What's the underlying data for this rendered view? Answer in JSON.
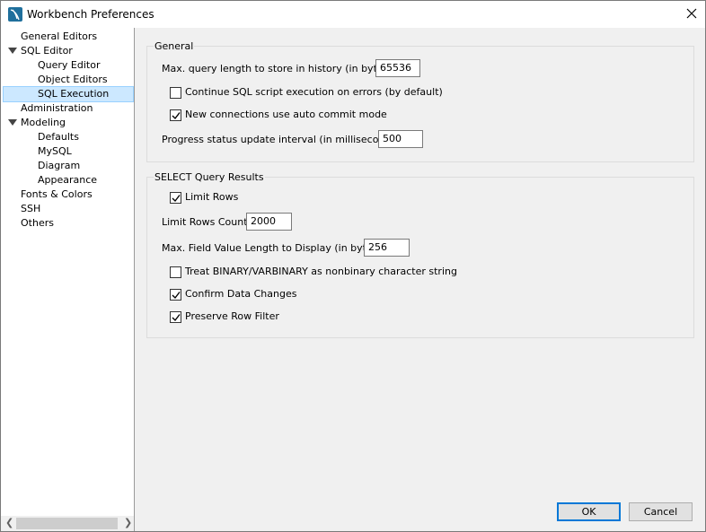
{
  "window": {
    "title": "Workbench Preferences"
  },
  "tree": {
    "items": [
      {
        "label": "General Editors"
      },
      {
        "label": "SQL Editor"
      },
      {
        "label": "Query Editor"
      },
      {
        "label": "Object Editors"
      },
      {
        "label": "SQL Execution",
        "selected": true
      },
      {
        "label": "Administration"
      },
      {
        "label": "Modeling"
      },
      {
        "label": "Defaults"
      },
      {
        "label": "MySQL"
      },
      {
        "label": "Diagram"
      },
      {
        "label": "Appearance"
      },
      {
        "label": "Fonts & Colors"
      },
      {
        "label": "SSH"
      },
      {
        "label": "Others"
      }
    ]
  },
  "general": {
    "title": "General",
    "max_query_label": "Max. query length to store in history (in bytes):",
    "max_query_value": "65536",
    "continue_label": "Continue SQL script execution on errors (by default)",
    "continue_checked": false,
    "autocommit_label": "New connections use auto commit mode",
    "autocommit_checked": true,
    "progress_label": "Progress status update interval (in milliseconds):",
    "progress_value": "500"
  },
  "select_results": {
    "title": "SELECT Query Results",
    "limit_rows_label": "Limit Rows",
    "limit_rows_checked": true,
    "limit_count_label": "Limit Rows Count:",
    "limit_count_value": "2000",
    "max_field_label": "Max. Field Value Length to Display (in bytes):",
    "max_field_value": "256",
    "binary_label": "Treat BINARY/VARBINARY as nonbinary character string",
    "binary_checked": false,
    "confirm_label": "Confirm Data Changes",
    "confirm_checked": true,
    "preserve_label": "Preserve Row Filter",
    "preserve_checked": true
  },
  "buttons": {
    "ok": "OK",
    "cancel": "Cancel"
  },
  "icons": {
    "app": "mysql-dolphin-icon",
    "close": "close-icon",
    "expand": "triangle-down-icon",
    "check": "checkmark-icon"
  }
}
